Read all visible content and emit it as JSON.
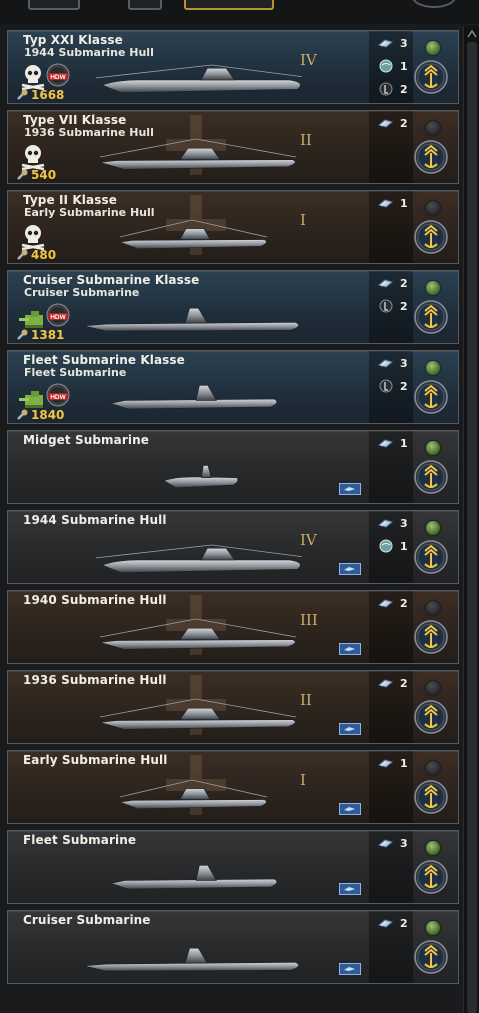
{
  "colors": {
    "blue_card": "#243746",
    "brown_card": "#2f251f",
    "grey_card": "#2a2c2e",
    "cost": "#f4c543",
    "tier": "#c9ab6a",
    "active_tab": "#b8952a"
  },
  "cards": [
    {
      "name": "Typ XXI Klasse",
      "subtitle": "1944 Submarine Hull",
      "tier": "IV",
      "cost": "1668",
      "bg": "blue",
      "icons": "skull-hdw",
      "light": "on",
      "ship": "xxi",
      "stats": [
        {
          "icon": "torpedo-icon",
          "value": "3"
        },
        {
          "icon": "sonar-icon",
          "value": "1"
        },
        {
          "icon": "snorkel-icon",
          "value": "2"
        }
      ]
    },
    {
      "name": "Type VII Klasse",
      "subtitle": "1936 Submarine Hull",
      "tier": "II",
      "cost": "540",
      "bg": "brown",
      "icons": "skull",
      "light": "off",
      "ship": "vii",
      "stats": [
        {
          "icon": "torpedo-icon",
          "value": "2"
        }
      ]
    },
    {
      "name": "Type II Klasse",
      "subtitle": "Early Submarine Hull",
      "tier": "I",
      "cost": "480",
      "bg": "brown",
      "icons": "skull",
      "light": "off",
      "ship": "ii",
      "stats": [
        {
          "icon": "torpedo-icon",
          "value": "1"
        }
      ]
    },
    {
      "name": "Cruiser Submarine Klasse",
      "subtitle": "Cruiser Submarine",
      "tier": "",
      "cost": "1381",
      "bg": "blue",
      "icons": "gun-hdw",
      "light": "on",
      "ship": "cruiser",
      "stats": [
        {
          "icon": "torpedo-icon",
          "value": "2"
        },
        {
          "icon": "snorkel-icon",
          "value": "2"
        }
      ]
    },
    {
      "name": "Fleet Submarine Klasse",
      "subtitle": "Fleet Submarine",
      "tier": "",
      "cost": "1840",
      "bg": "blue",
      "icons": "gun-hdw",
      "light": "on",
      "ship": "fleet",
      "stats": [
        {
          "icon": "torpedo-icon",
          "value": "3"
        },
        {
          "icon": "snorkel-icon",
          "value": "2"
        }
      ]
    },
    {
      "name": "Midget Submarine",
      "subtitle": "",
      "tier": "",
      "cost": "",
      "bg": "grey",
      "icons": "",
      "light": "on",
      "ship": "midget",
      "tag": true,
      "stats": [
        {
          "icon": "torpedo-icon",
          "value": "1"
        }
      ]
    },
    {
      "name": "1944 Submarine Hull",
      "subtitle": "",
      "tier": "IV",
      "cost": "",
      "bg": "grey",
      "icons": "",
      "light": "on",
      "ship": "xxi",
      "tag": true,
      "stats": [
        {
          "icon": "torpedo-icon",
          "value": "3"
        },
        {
          "icon": "sonar-icon",
          "value": "1"
        }
      ]
    },
    {
      "name": "1940 Submarine Hull",
      "subtitle": "",
      "tier": "III",
      "cost": "",
      "bg": "brown",
      "icons": "",
      "light": "off",
      "ship": "vii",
      "tag": true,
      "stats": [
        {
          "icon": "torpedo-icon",
          "value": "2"
        }
      ]
    },
    {
      "name": "1936 Submarine Hull",
      "subtitle": "",
      "tier": "II",
      "cost": "",
      "bg": "brown",
      "icons": "",
      "light": "off",
      "ship": "vii",
      "tag": true,
      "stats": [
        {
          "icon": "torpedo-icon",
          "value": "2"
        }
      ]
    },
    {
      "name": "Early Submarine Hull",
      "subtitle": "",
      "tier": "I",
      "cost": "",
      "bg": "brown",
      "icons": "",
      "light": "off",
      "ship": "ii",
      "tag": true,
      "stats": [
        {
          "icon": "torpedo-icon",
          "value": "1"
        }
      ]
    },
    {
      "name": "Fleet Submarine",
      "subtitle": "",
      "tier": "",
      "cost": "",
      "bg": "grey",
      "icons": "",
      "light": "on",
      "ship": "fleet",
      "tag": true,
      "stats": [
        {
          "icon": "torpedo-icon",
          "value": "3"
        }
      ]
    },
    {
      "name": "Cruiser Submarine",
      "subtitle": "",
      "tier": "",
      "cost": "",
      "bg": "grey",
      "icons": "",
      "light": "on",
      "ship": "cruiser",
      "tag": true,
      "stats": [
        {
          "icon": "torpedo-icon",
          "value": "2"
        }
      ]
    }
  ]
}
